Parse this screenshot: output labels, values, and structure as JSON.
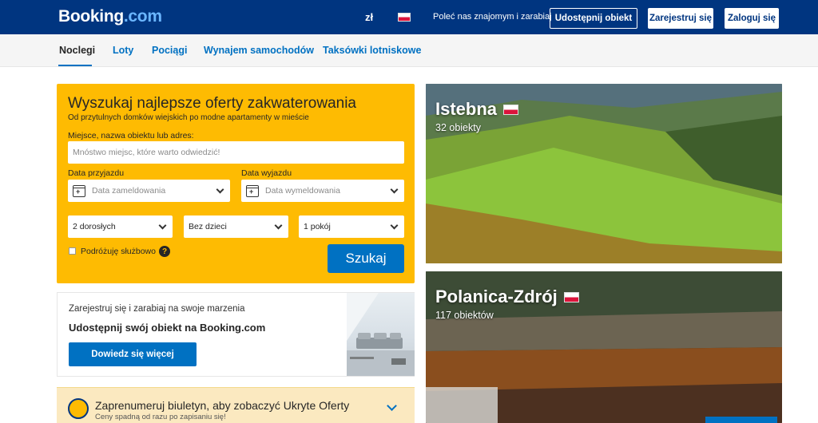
{
  "header": {
    "logo_main": "Booking",
    "logo_suffix": ".com",
    "currency": "zł",
    "refer_text": "Poleć nas znajomym i zarabiaj",
    "list_property": "Udostępnij obiekt",
    "register": "Zarejestruj się",
    "login": "Zaloguj się"
  },
  "nav": {
    "tabs": [
      "Noclegi",
      "Loty",
      "Pociągi",
      "Wynajem samochodów",
      "Taksówki lotniskowe"
    ],
    "active": "Noclegi"
  },
  "search": {
    "title": "Wyszukaj najlepsze oferty zakwaterowania",
    "subtitle": "Od przytulnych domków wiejskich po modne apartamenty w mieście",
    "destination_label": "Miejsce, nazwa obiektu lub adres:",
    "destination_placeholder": "Mnóstwo miejsc, które warto odwiedzić!",
    "checkin_label": "Data przyjazdu",
    "checkin_placeholder": "Data zameldowania",
    "checkout_label": "Data wyjazdu",
    "checkout_placeholder": "Data wymeldowania",
    "adults": "2 dorosłych",
    "children": "Bez dzieci",
    "rooms": "1 pokój",
    "business_label": "Podróżuję służbowo",
    "search_button": "Szukaj"
  },
  "promo": {
    "line1": "Zarejestruj się i zarabiaj na swoje marzenia",
    "line2": "Udostępnij swój obiekt na Booking.com",
    "button": "Dowiedz się więcej"
  },
  "newsletter": {
    "title": "Zaprenumeruj biuletyn, aby zobaczyć Ukryte Oferty",
    "subtitle": "Ceny spadną od razu po zapisaniu się!"
  },
  "destinations": [
    {
      "name": "Istebna",
      "count": "32 obiekty"
    },
    {
      "name": "Polanica-Zdrój",
      "count": "117 obiektów"
    }
  ],
  "colors": {
    "brand_blue": "#003580",
    "accent_blue": "#0071c2",
    "search_yellow": "#febb02"
  }
}
